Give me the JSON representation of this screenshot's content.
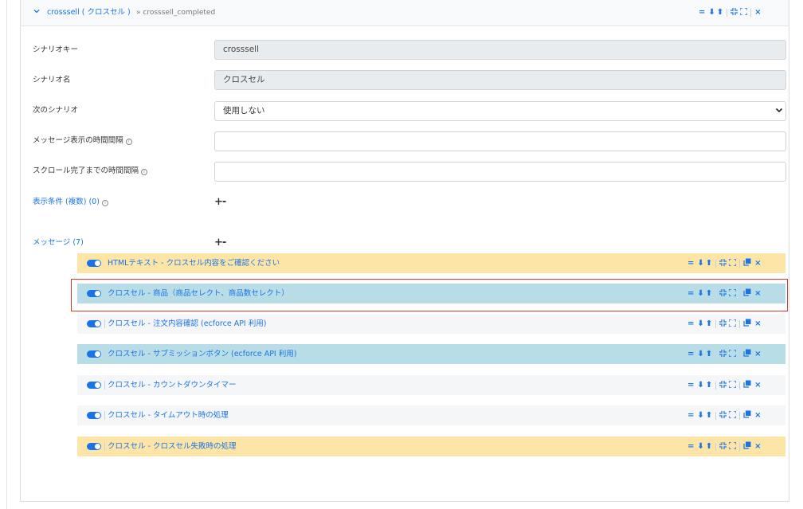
{
  "scenario": {
    "header_title": "crosssell ( クロスセル )",
    "header_sub": "» crosssell_completed",
    "fields": [
      {
        "label": "シナリオキー",
        "value": "crosssell",
        "type": "readonly"
      },
      {
        "label": "シナリオ名",
        "value": "クロスセル",
        "type": "readonly"
      },
      {
        "label": "次のシナリオ",
        "value": "使用しない",
        "type": "select"
      },
      {
        "label": "メッセージ表示の時間間隔",
        "value": "",
        "type": "text",
        "info": true
      },
      {
        "label": "スクロール完了までの時間間隔",
        "value": "",
        "type": "text",
        "info": true
      }
    ],
    "conditions_label": "表示条件 (複数) (0)",
    "messages_label": "メッセージ (7)",
    "plus_minus": "+-"
  },
  "messages": [
    {
      "label": "HTMLテキスト - クロスセル内容をご確認ください",
      "color": "#fde5a8"
    },
    {
      "label": "クロスセル - 商品（商品セレクト、商品数セレクト）",
      "color": "#b8dde6"
    },
    {
      "label": "クロスセル - 注文内容確認 (ecforce API 利用)",
      "color": "#f5f6f8"
    },
    {
      "label": "クロスセル - サブミッションボタン (ecforce API 利用)",
      "color": "#b8dde6"
    },
    {
      "label": "クロスセル - カウントダウンタイマー",
      "color": "#f5f6f8"
    },
    {
      "label": "クロスセル - タイムアウト時の処理",
      "color": "#f5f6f8"
    },
    {
      "label": "クロスセル - クロスセル失敗時の処理",
      "color": "#fde5a8"
    }
  ],
  "icons": {
    "sort": "=",
    "down": "⬇",
    "up": "⬆",
    "collapse": "collapse-icon",
    "expand": "expand-icon",
    "copy": "copy-icon",
    "close": "×",
    "chevron": "⌄"
  },
  "accent_color": "#1a73e8",
  "highlight_color": "#e0332b"
}
